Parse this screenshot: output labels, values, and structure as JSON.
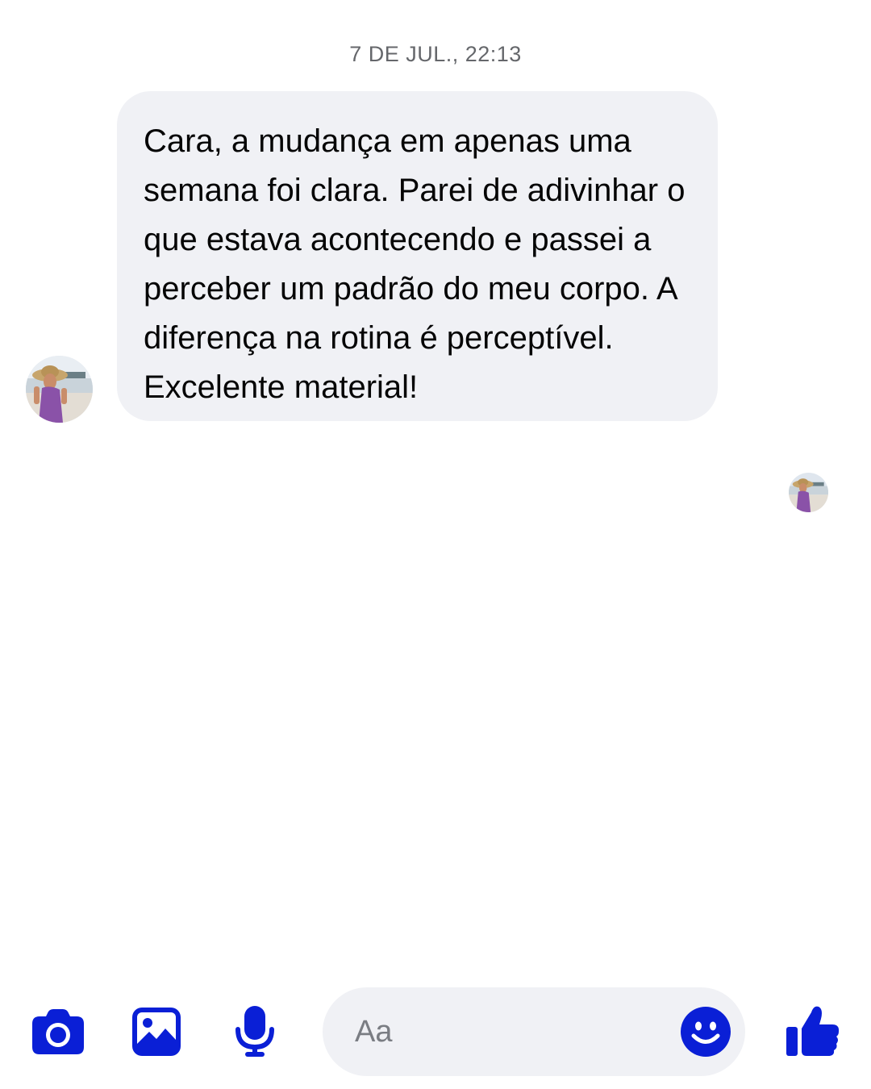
{
  "conversation": {
    "timestamp": "7 DE JUL., 22:13",
    "message": {
      "text": "Cara, a mudança em apenas uma semana foi clara. Parei de adivinhar o que estava acontecendo e passei a perceber um padrão do meu corpo. A diferença na rotina é perceptível. Excelente material!"
    }
  },
  "composer": {
    "placeholder": "Aa",
    "icons": [
      "camera-icon",
      "gallery-icon",
      "microphone-icon",
      "emoji-icon",
      "thumbs-up-icon"
    ]
  },
  "colors": {
    "accent": "#0A1FD6",
    "bubble": "#F0F1F5",
    "timestamp": "#65676B"
  }
}
